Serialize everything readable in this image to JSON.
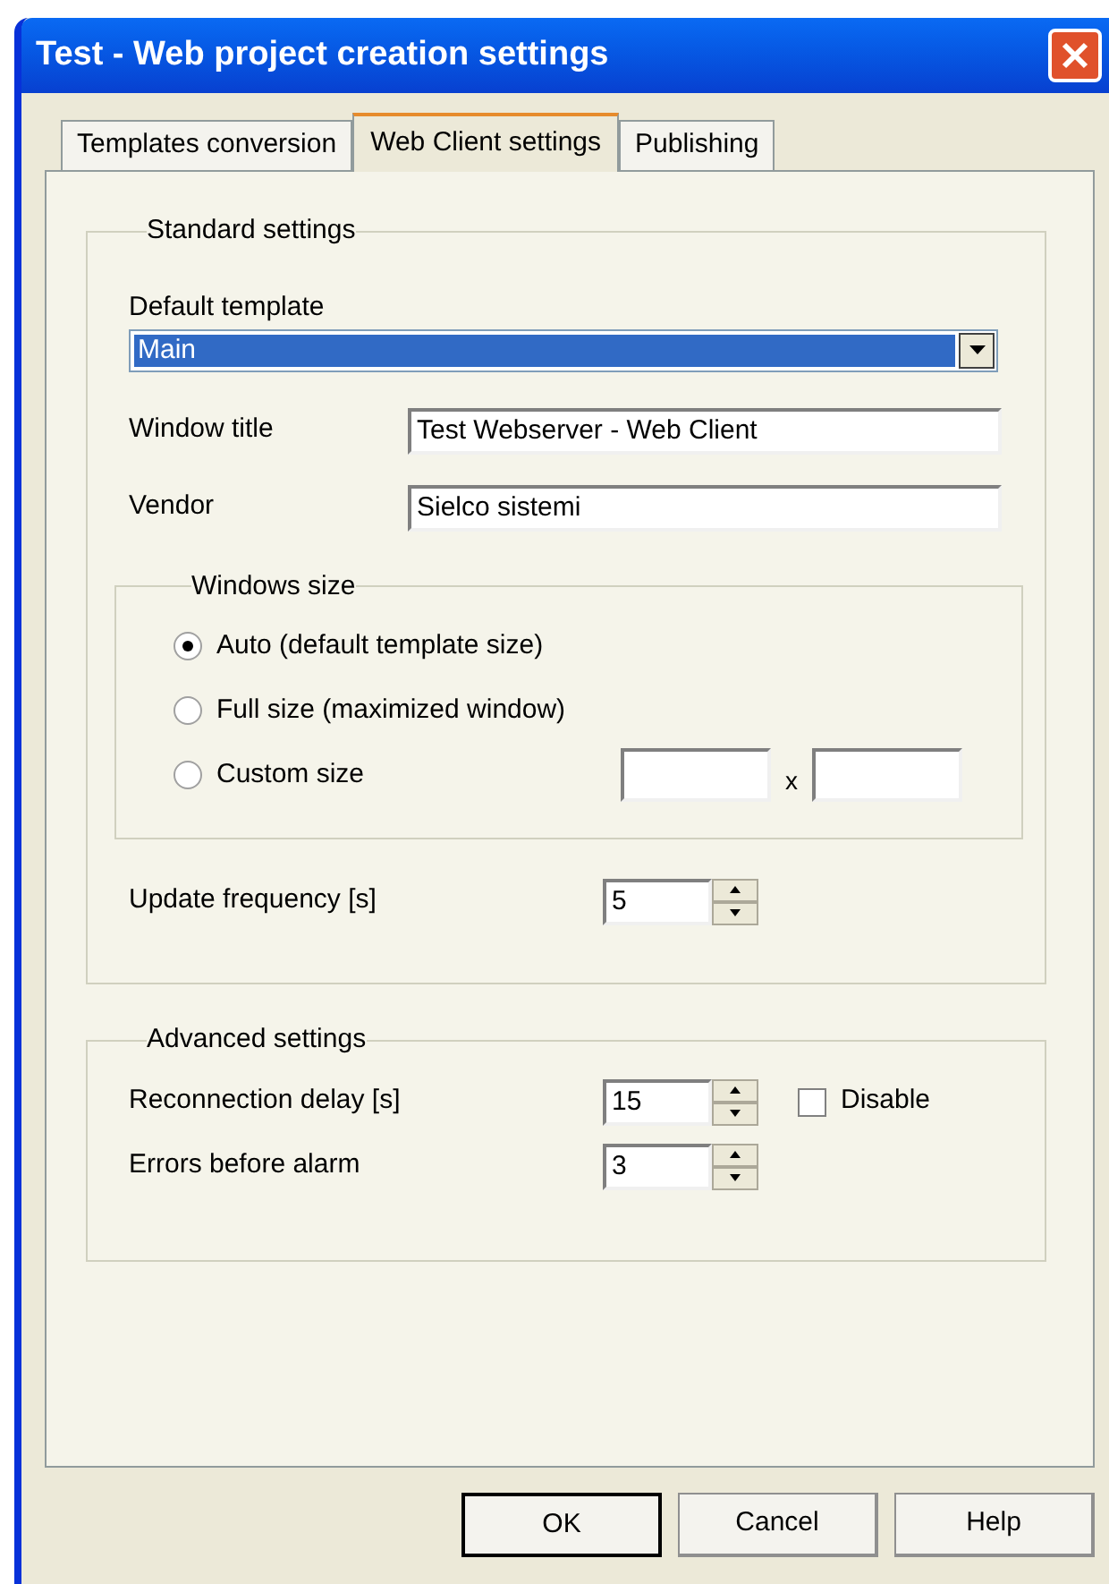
{
  "window": {
    "title": "Test - Web project creation settings"
  },
  "tabs": [
    {
      "label": "Templates conversion",
      "selected": false
    },
    {
      "label": "Web Client settings",
      "selected": true
    },
    {
      "label": "Publishing",
      "selected": false
    }
  ],
  "standard_settings": {
    "title": "Standard settings",
    "default_template": {
      "label": "Default template",
      "value": "Main"
    },
    "fields": [
      {
        "label": "Window title",
        "value": "Test Webserver - Web Client"
      },
      {
        "label": "Vendor",
        "value": "Sielco sistemi"
      }
    ],
    "windows_size": {
      "title": "Windows size",
      "options": [
        {
          "label": "Auto (default template size)",
          "selected": true
        },
        {
          "label": "Full size (maximized window)",
          "selected": false
        },
        {
          "label": "Custom size",
          "selected": false
        }
      ],
      "separator": "x"
    },
    "update_frequency": {
      "label": "Update frequency [s]",
      "value": "5"
    }
  },
  "advanced_settings": {
    "title": "Advanced settings",
    "reconnection_delay": {
      "label": "Reconnection delay [s]",
      "value": "15"
    },
    "disable": {
      "label": "Disable",
      "checked": false
    },
    "errors_before_alarm": {
      "label": "Errors before alarm",
      "value": "3"
    }
  },
  "buttons": [
    {
      "label": "OK",
      "default": true
    },
    {
      "label": "Cancel",
      "default": false
    },
    {
      "label": "Help",
      "default": false
    }
  ]
}
